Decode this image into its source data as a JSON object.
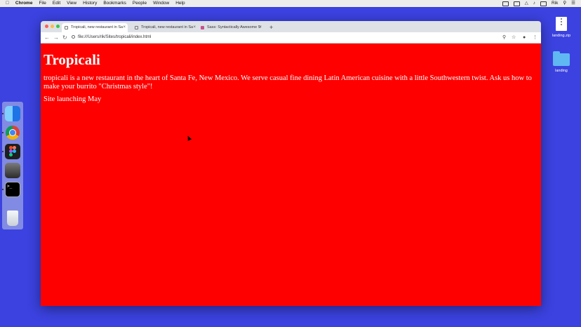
{
  "menubar": {
    "app": "Chrome",
    "items": [
      "File",
      "Edit",
      "View",
      "History",
      "Bookmarks",
      "People",
      "Window",
      "Help"
    ],
    "user": "Rik"
  },
  "desktop": {
    "icons": [
      {
        "label": "landing.zip"
      },
      {
        "label": "landing"
      }
    ]
  },
  "browser": {
    "tabs": [
      {
        "label": "Tropicali, new restaurant in Sa"
      },
      {
        "label": "Tropicali, new restaurant in Sa"
      },
      {
        "label": "Sass: Syntactically Awesome S"
      }
    ],
    "new_tab": "+",
    "url": "file:///Users/rik/Sites/tropicali/index.html"
  },
  "page": {
    "heading": "Tropicali",
    "intro": "tropicali is a new restaurant in the heart of Santa Fe, New Mexico. We serve casual fine dining Latin American cuisine with a little Southwestern twist. Ask us how to make your burrito \"Christmas style\"!",
    "launch": "Site launching May"
  }
}
